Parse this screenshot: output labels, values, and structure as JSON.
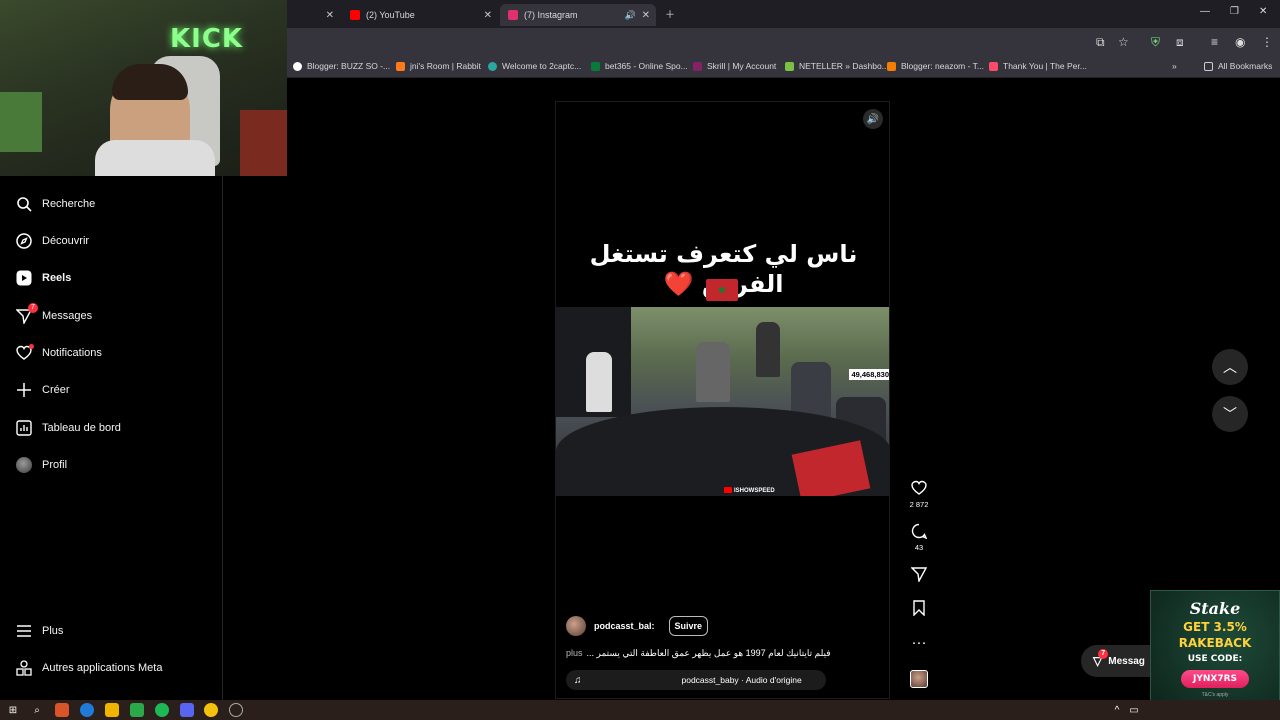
{
  "browser": {
    "tabs": [
      {
        "label": "(2) YouTube",
        "favicon_color": "#ff0000"
      },
      {
        "label": "(7) Instagram",
        "favicon_color": "#e1306c"
      }
    ],
    "bookmarks": [
      {
        "label": "Blogger: BUZZ SO -...",
        "color": "#ffffff"
      },
      {
        "label": "jni's Room | Rabbit",
        "color": "#ff7a1a"
      },
      {
        "label": "Welcome to 2captc...",
        "color": "#2aa8a0"
      },
      {
        "label": "bet365 - Online Spo...",
        "color": "#0a7a3a"
      },
      {
        "label": "Skrill | My Account",
        "color": "#862165"
      },
      {
        "label": "NETELLER » Dashbo...",
        "color": "#7ac143"
      },
      {
        "label": "Blogger: neazom - T...",
        "color": "#f57d00"
      },
      {
        "label": "Thank You | The Per...",
        "color": "#ff4a6a"
      }
    ],
    "all_bookmarks": "All Bookmarks"
  },
  "sidebar": {
    "items": [
      {
        "label": "Recherche",
        "icon": "search-icon"
      },
      {
        "label": "Découvrir",
        "icon": "compass-icon"
      },
      {
        "label": "Reels",
        "icon": "reels-icon"
      },
      {
        "label": "Messages",
        "icon": "messenger-icon",
        "badge": "7"
      },
      {
        "label": "Notifications",
        "icon": "heart-icon"
      },
      {
        "label": "Créer",
        "icon": "plus-icon"
      },
      {
        "label": "Tableau de bord",
        "icon": "dashboard-icon"
      },
      {
        "label": "Profil",
        "icon": "avatar"
      }
    ],
    "bottom": [
      {
        "label": "Plus",
        "icon": "menu-icon"
      },
      {
        "label": "Autres applications Meta",
        "icon": "meta-apps-icon"
      }
    ]
  },
  "reel": {
    "overlay_text": "ناس لي كتعرف تستغل الفرص ❤️",
    "counter": "49,468,830",
    "watermark": "ISHOWSPEED",
    "author": "podcasst_bal:",
    "follow_label": "Suivre",
    "description": "فيلم تايتانيك لعام 1997 هو عمل يظهر عمق العاطفة التي يستمر ...",
    "more_label": "plus",
    "audio": "podcasst_baby · Audio d'origine"
  },
  "actions": {
    "likes": "2 872",
    "comments": "43"
  },
  "messages_pill": {
    "label": "Messag",
    "badge": "7"
  },
  "stake_ad": {
    "logo": "Stake",
    "line1": "GET 3.5%",
    "line2": "RAKEBACK",
    "use_code": "USE CODE:",
    "code": "JYNX7RS",
    "tc": "T&C's apply"
  },
  "colors": {
    "accent_red": "#ff3040",
    "background": "#000000"
  }
}
